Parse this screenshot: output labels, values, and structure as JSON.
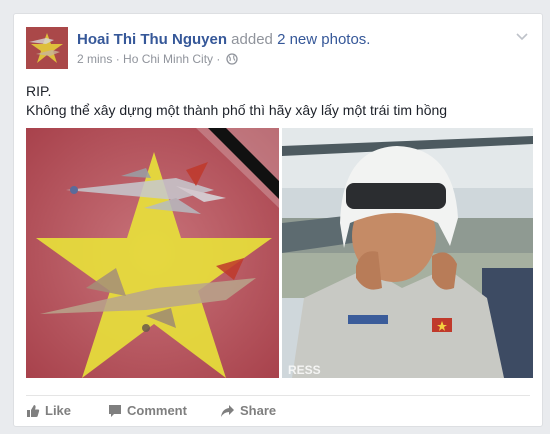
{
  "post": {
    "author": "Hoai Thi Thu Nguyen",
    "action_text": "added",
    "action_link": "2 new photos.",
    "time": "2 mins",
    "separator": "·",
    "location": "Ho Chi Minh City",
    "privacy_separator": "·",
    "message_lines": [
      "RIP.",
      "Không thể xây dựng một thành phố thì hãy xây lấy một trái tim hồng"
    ]
  },
  "photos": {
    "right_watermark": "RESS"
  },
  "actions": {
    "like": "Like",
    "comment": "Comment",
    "share": "Share"
  },
  "colors": {
    "name_link": "#365899",
    "flag_red": "#da251d",
    "flag_star": "#ffff00",
    "action_gray": "#7f7f7f"
  },
  "icons": [
    "chevron-down-icon",
    "globe-icon",
    "like-icon",
    "comment-icon",
    "share-icon",
    "mourning-ribbon"
  ]
}
